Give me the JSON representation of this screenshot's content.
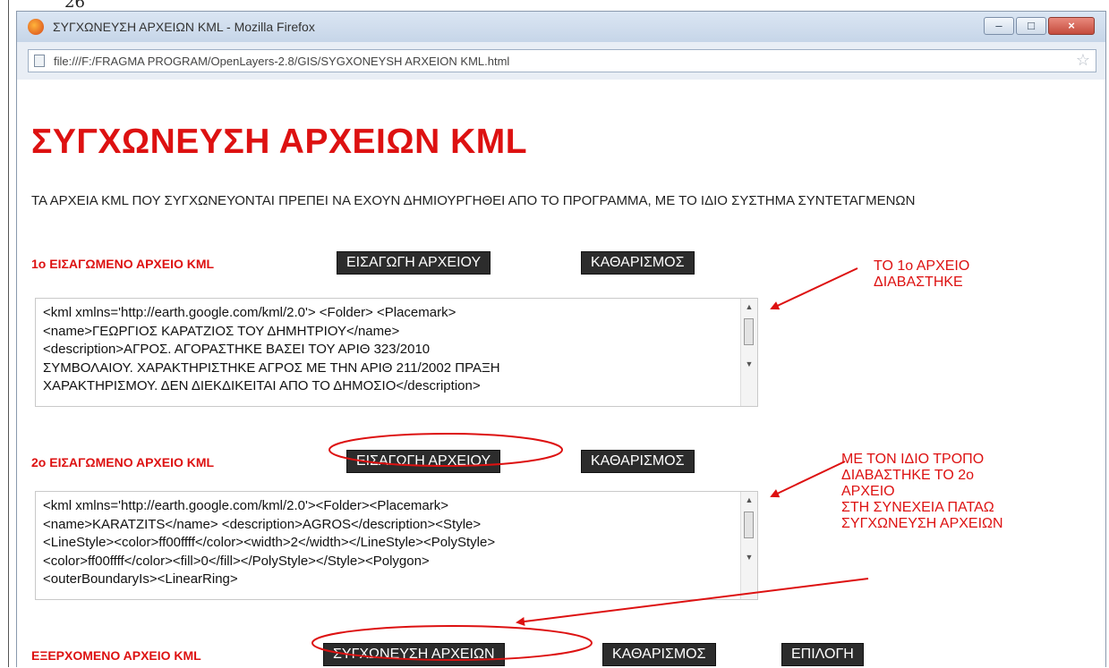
{
  "page_number": "26",
  "window": {
    "title": "ΣΥΓΧΩΝΕΥΣΗ ΑΡΧΕΙΩΝ KML - Mozilla Firefox",
    "controls": {
      "minimize": "–",
      "maximize": "□",
      "close": "×"
    },
    "address": "file:///F:/FRAGMA PROGRAM/OpenLayers-2.8/GIS/SYGXONEYSH ARXEION KML.html"
  },
  "page": {
    "heading": "ΣΥΓΧΩΝΕΥΣΗ ΑΡΧΕΙΩΝ KML",
    "intro": "ΤΑ ΑΡΧΕΙΑ KML ΠΟΥ ΣΥΓΧΩΝΕΥΟΝΤΑΙ ΠΡΕΠΕΙ ΝΑ ΕΧΟΥΝ ΔΗΜΙΟΥΡΓΗΘΕΙ ΑΠΟ ΤΟ ΠΡΟΓΡΑΜΜΑ, ΜΕ ΤΟ ΙΔΙΟ ΣΥΣΤΗΜΑ ΣΥΝΤΕΤΑΓΜΕΝΩΝ",
    "file1": {
      "label": "1ο ΕΙΣΑΓΩΜΕΝΟ ΑΡΧΕΙΟ KML",
      "import_button": "ΕΙΣΑΓΩΓΗ ΑΡΧΕΙΟΥ",
      "clear_button": "ΚΑΘΑΡΙΣΜΟΣ",
      "content": "<kml xmlns='http://earth.google.com/kml/2.0'> <Folder> <Placemark>\n<name>ΓΕΩΡΓΙΟΣ ΚΑΡΑΤΖΙΟΣ ΤΟΥ ΔΗΜΗΤΡΙΟΥ</name>\n<description>ΑΓΡΟΣ. ΑΓΟΡΑΣΤΗΚΕ ΒΑΣΕΙ ΤΟΥ ΑΡΙΘ 323/2010\nΣΥΜΒΟΛΑΙΟΥ. ΧΑΡΑΚΤΗΡΙΣΤΗΚΕ ΑΓΡΟΣ ΜΕ ΤΗΝ ΑΡΙΘ 211/2002 ΠΡΑΞΗ\nΧΑΡΑΚΤΗΡΙΣΜΟΥ. ΔΕΝ ΔΙΕΚΔΙΚΕΙΤΑΙ ΑΠΟ ΤΟ ΔΗΜΟΣΙΟ</description>"
    },
    "file2": {
      "label": "2ο ΕΙΣΑΓΩΜΕΝΟ ΑΡΧΕΙΟ KML",
      "import_button": "ΕΙΣΑΓΩΓΗ ΑΡΧΕΙΟΥ",
      "clear_button": "ΚΑΘΑΡΙΣΜΟΣ",
      "content": "<kml xmlns='http://earth.google.com/kml/2.0'><Folder><Placemark>\n<name>KARATZITS</name> <description>AGROS</description><Style>\n<LineStyle><color>ff00ffff</color><width>2</width></LineStyle><PolyStyle>\n<color>ff00ffff</color><fill>0</fill></PolyStyle></Style><Polygon>\n<outerBoundaryIs><LinearRing>"
    },
    "output": {
      "label": "ΕΞΕΡΧΟΜΕΝΟ ΑΡΧΕΙΟ KML",
      "merge_button": "ΣΥΓΧΩΝΕΥΣΗ ΑΡΧΕΙΩΝ",
      "clear_button": "ΚΑΘΑΡΙΣΜΟΣ",
      "select_button": "ΕΠΙΛΟΓΗ"
    }
  },
  "annotations": {
    "note1": "ΤΟ 1ο ΑΡΧΕΙΟ\nΔΙΑΒΑΣΤΗΚΕ",
    "note2": "ΜΕ ΤΟΝ ΙΔΙΟ ΤΡΟΠΟ\nΔΙΑΒΑΣΤΗΚΕ ΤΟ 2ο\nΑΡΧΕΙΟ\nΣΤΗ ΣΥΝΕΧΕΙΑ ΠΑΤΑΩ\nΣΥΓΧΩΝΕΥΣΗ ΑΡΧΕΙΩΝ",
    "color": "#dd1111"
  }
}
